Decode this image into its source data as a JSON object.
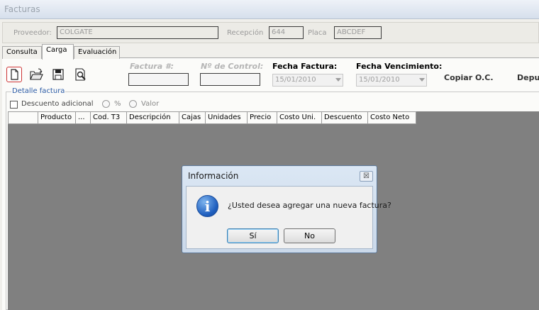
{
  "window": {
    "title": "Facturas"
  },
  "header": {
    "proveedor_label": "Proveedor:",
    "proveedor_value": "COLGATE",
    "recepcion_label": "Recepción",
    "recepcion_value": "644",
    "placa_label": "Placa",
    "placa_value": "ABCDEF"
  },
  "tabs": [
    {
      "label": "Consulta"
    },
    {
      "label": "Carga",
      "active": true
    },
    {
      "label": "Evaluación"
    }
  ],
  "toolbar": {
    "icons": [
      "new-document-icon",
      "open-folder-icon",
      "save-disk-icon",
      "print-preview-icon"
    ]
  },
  "form": {
    "factura_label": "Factura #:",
    "control_label": "Nº de Control:",
    "fecha_factura_label": "Fecha Factura:",
    "fecha_factura_value": "15/01/2010",
    "fecha_venc_label": "Fecha Vencimiento:",
    "fecha_venc_value": "15/01/2010",
    "copiar_oc": "Copiar O.C.",
    "depu": "Depu"
  },
  "detalle": {
    "legend": "Detalle factura",
    "descuento_adicional": "Descuento adicional",
    "pct_label": "%",
    "valor_label": "Valor"
  },
  "grid": {
    "columns": [
      "",
      "Producto",
      "...",
      "Cod. T3",
      "Descripción",
      "Cajas",
      "Unidades",
      "Precio",
      "Costo Uni.",
      "Descuento",
      "Costo Neto"
    ]
  },
  "dialog": {
    "title": "Información",
    "close": "☒",
    "icon_text": "i",
    "message": "¿Usted desea agregar una nueva factura?",
    "yes": "Sí",
    "no": "No"
  }
}
